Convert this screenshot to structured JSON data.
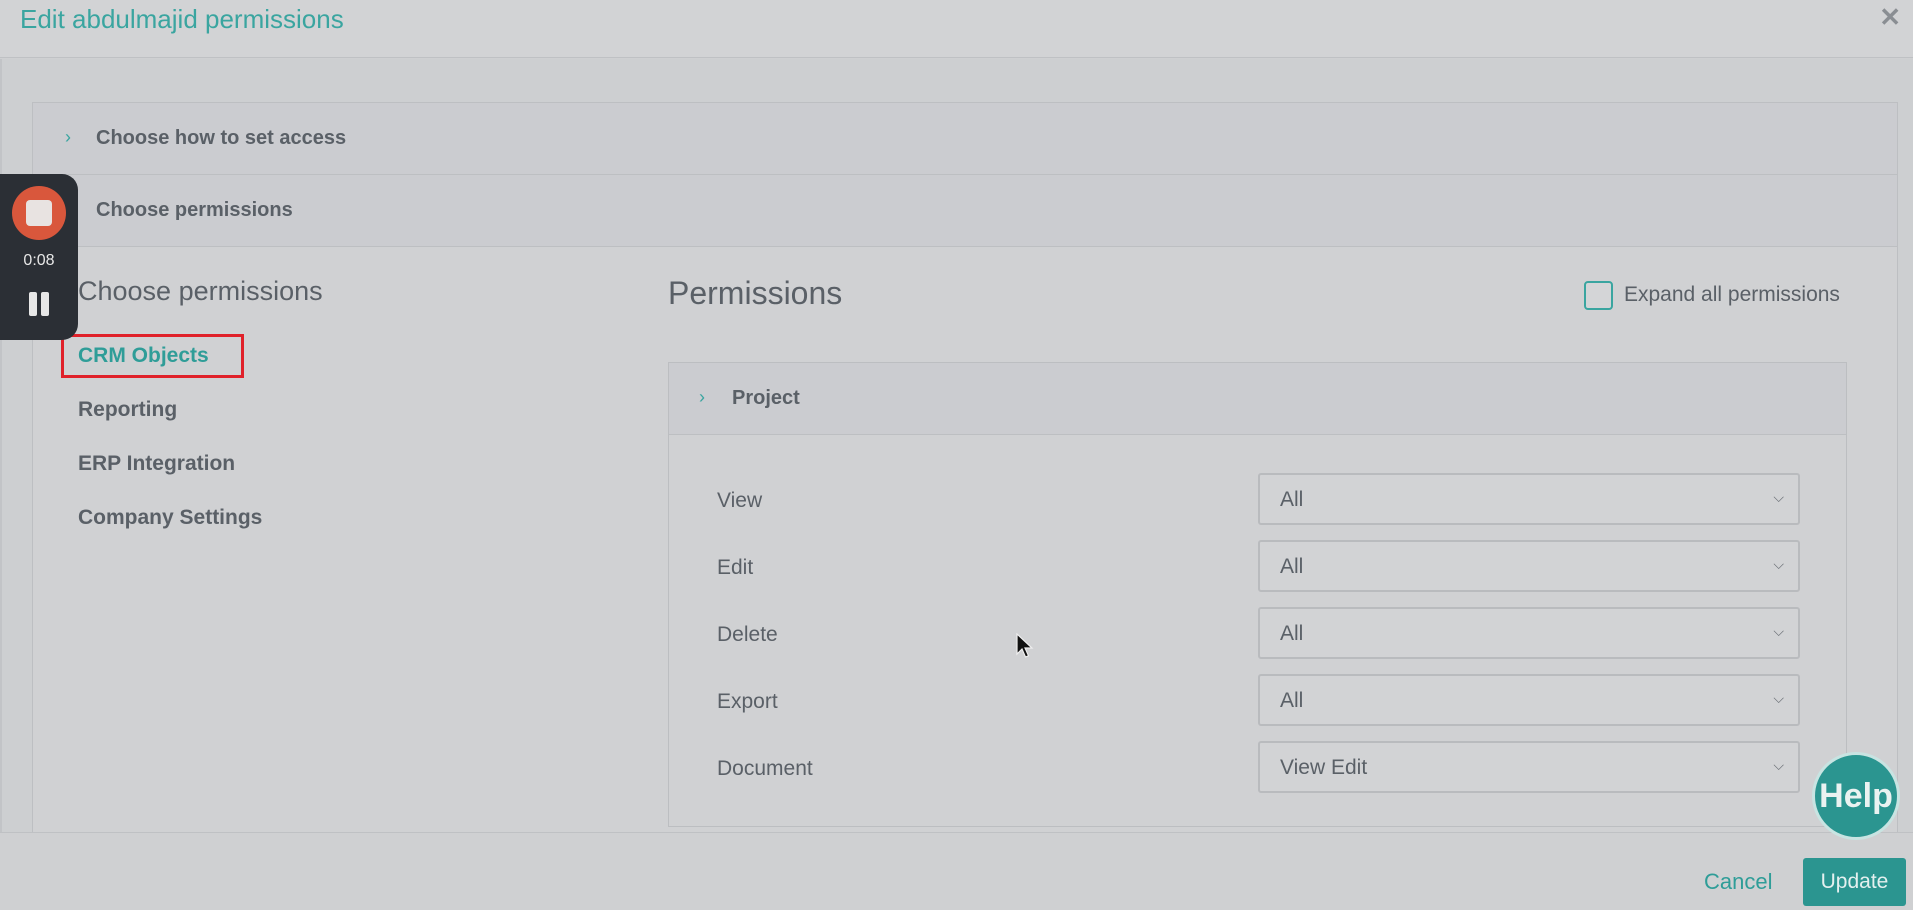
{
  "modal": {
    "title": "Edit abdulmajid permissions",
    "close_icon": "close-icon"
  },
  "sections": [
    {
      "label": "Choose how to set access",
      "icon": "chevron-right-icon"
    },
    {
      "label": "Choose permissions"
    }
  ],
  "left_panel": {
    "title": "Choose permissions",
    "items": [
      {
        "label": "CRM Objects",
        "active": true
      },
      {
        "label": "Reporting"
      },
      {
        "label": "ERP Integration"
      },
      {
        "label": "Company Settings"
      }
    ]
  },
  "permissions": {
    "title": "Permissions",
    "expand_all_label": "Expand all permissions",
    "expand_all_checked": false,
    "group": {
      "label": "Project",
      "icon": "chevron-right-icon",
      "rows": [
        {
          "label": "View",
          "value": "All"
        },
        {
          "label": "Edit",
          "value": "All"
        },
        {
          "label": "Delete",
          "value": "All"
        },
        {
          "label": "Export",
          "value": "All"
        },
        {
          "label": "Document",
          "value": "View Edit"
        }
      ]
    }
  },
  "footer": {
    "cancel_label": "Cancel",
    "update_label": "Update"
  },
  "recorder": {
    "time": "0:08"
  },
  "help": {
    "label": "Help"
  },
  "colors": {
    "accent": "#3aa5a0",
    "highlight": "#e0212a",
    "recorder_stop": "#d9573c"
  }
}
